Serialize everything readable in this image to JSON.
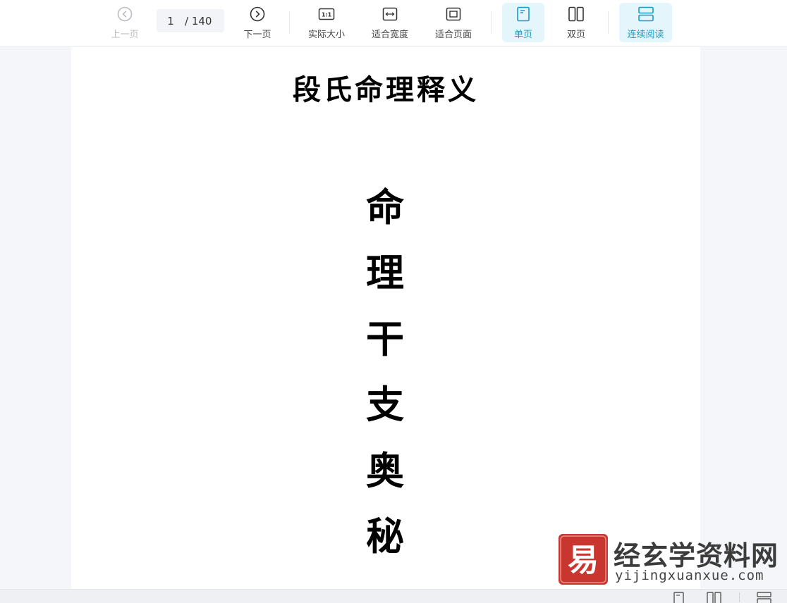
{
  "toolbar": {
    "prev_label": "上一页",
    "page_current": "1",
    "page_total": "/ 140",
    "next_label": "下一页",
    "actual_size_label": "实际大小",
    "fit_width_label": "适合宽度",
    "fit_page_label": "适合页面",
    "single_page_label": "单页",
    "double_page_label": "双页",
    "continuous_label": "连续阅读",
    "accent_color": "#1a9cc8",
    "active_bg": "#e4f5fb",
    "icons": {
      "prev": "chevron-left-circle-icon",
      "next": "chevron-right-circle-icon",
      "actual_size": "one-to-one-icon",
      "fit_width": "fit-width-icon",
      "fit_page": "fit-page-icon",
      "single_page": "single-page-icon",
      "double_page": "double-page-icon",
      "continuous": "continuous-scroll-icon"
    }
  },
  "document": {
    "title": "段氏命理释义",
    "vertical_chars": [
      "命",
      "理",
      "干",
      "支",
      "奥",
      "秘"
    ]
  },
  "watermark": {
    "logo_char": "易",
    "site_name_cn": "经玄学资料网",
    "site_url": "yijingxuanxue.com",
    "logo_color": "#c8362f"
  }
}
